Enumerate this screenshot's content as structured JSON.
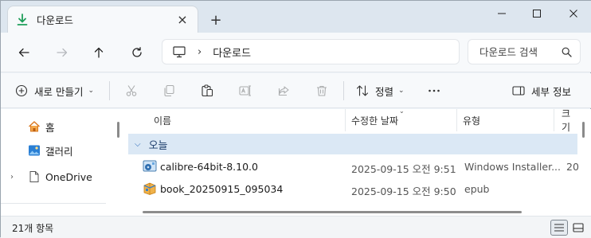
{
  "tab": {
    "title": "다운로드"
  },
  "address": {
    "crumbs": [
      "다운로드"
    ]
  },
  "search": {
    "placeholder": "다운로드 검색"
  },
  "commands": {
    "new": "새로 만들기",
    "sort": "정렬",
    "details": "세부 정보"
  },
  "nav": {
    "items": [
      {
        "label": "홈",
        "icon": "home-icon"
      },
      {
        "label": "갤러리",
        "icon": "gallery-icon"
      },
      {
        "label": "OneDrive",
        "icon": "onedrive-icon"
      }
    ]
  },
  "columns": {
    "name": "이름",
    "modified": "수정한 날짜",
    "type": "유형",
    "size": "크기"
  },
  "group": {
    "label": "오늘"
  },
  "files": [
    {
      "name": "calibre-64bit-8.10.0",
      "modified": "2025-09-15 오전 9:51",
      "type": "Windows Installer...",
      "size": "20",
      "icon": "installer-icon"
    },
    {
      "name": "book_20250915_095034",
      "modified": "2025-09-15 오전 9:50",
      "type": "epub",
      "size": "",
      "icon": "epub-file-icon"
    }
  ],
  "status": {
    "count": "21개 항목"
  },
  "colors": {
    "accent": "#1b5fb3",
    "download_green": "#1e9e5a",
    "group_bg": "#dbe8f5"
  }
}
